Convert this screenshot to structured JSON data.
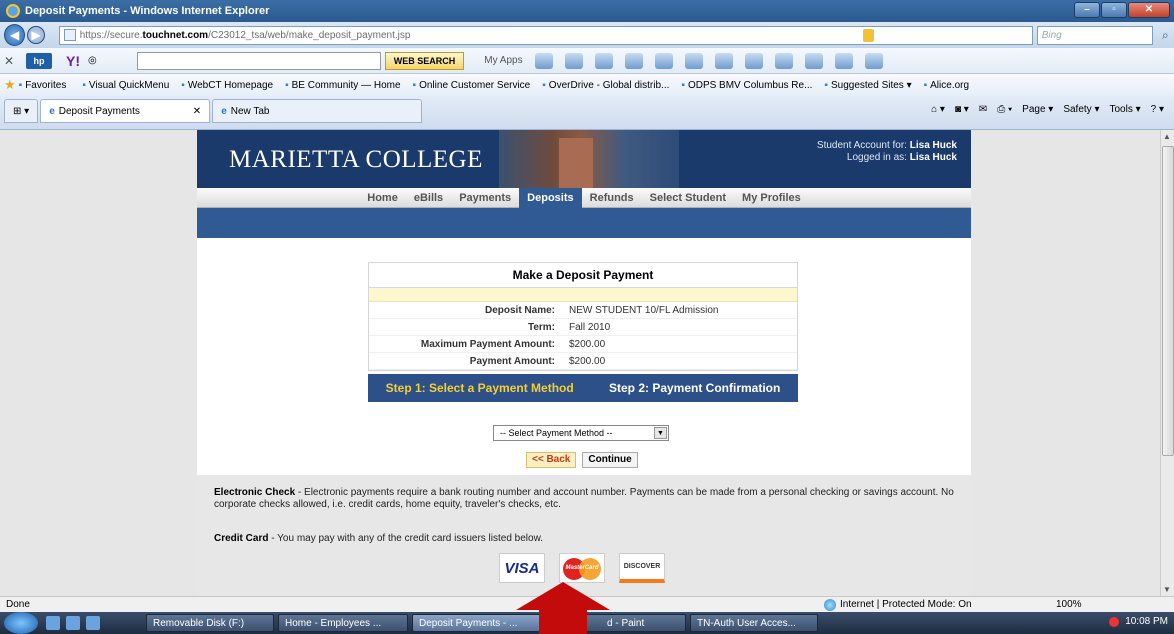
{
  "window": {
    "title": "Deposit Payments - Windows Internet Explorer"
  },
  "address": {
    "prefix": "https://secure.",
    "domain": "touchnet.com",
    "path": "/C23012_tsa/web/make_deposit_payment.jsp",
    "search_placeholder": "Bing"
  },
  "toolbar": {
    "websearch": "WEB SEARCH",
    "myapps": "My Apps"
  },
  "favorites": {
    "label": "Favorites",
    "items": [
      "Visual QuickMenu",
      "WebCT Homepage",
      "BE Community — Home",
      "Online Customer Service",
      "OverDrive - Global distrib...",
      "ODPS BMV Columbus Re...",
      "Suggested Sites ▾",
      "Alice.org"
    ]
  },
  "tabs": {
    "active": "Deposit Payments",
    "new": "New Tab"
  },
  "cmdbar": {
    "page": "Page ▾",
    "safety": "Safety ▾",
    "tools": "Tools ▾"
  },
  "site": {
    "college": "MARIETTA COLLEGE",
    "acct_label": "Student Account for:",
    "acct_name": "Lisa Huck",
    "login_label": "Logged in as:",
    "login_name": "Lisa Huck",
    "nav": [
      "Home",
      "eBills",
      "Payments",
      "Deposits",
      "Refunds",
      "Select Student",
      "My Profiles"
    ],
    "nav_active": "Deposits"
  },
  "deposit": {
    "title": "Make a Deposit Payment",
    "rows": [
      {
        "label": "Deposit Name:",
        "value": "NEW STUDENT 10/FL Admission"
      },
      {
        "label": "Term:",
        "value": "Fall 2010"
      },
      {
        "label": "Maximum Payment Amount:",
        "value": "$200.00"
      },
      {
        "label": "Payment Amount:",
        "value": "$200.00"
      }
    ]
  },
  "steps": {
    "step1": "Step 1: Select a Payment Method",
    "step2": "Step 2: Payment Confirmation"
  },
  "form": {
    "select_value": "-- Select Payment Method --",
    "back": "<< Back",
    "continue": "Continue"
  },
  "info": {
    "echeck_title": "Electronic Check",
    "echeck_text": " - Electronic payments require a bank routing number and account number. Payments can be made from a personal checking or savings account. No corporate checks allowed, i.e. credit cards, home equity, traveler's checks, etc.",
    "cc_title": "Credit Card",
    "cc_text": " - You may pay with any of the credit card issuers listed below."
  },
  "cards": {
    "visa": "VISA",
    "mastercard": "MasterCard",
    "discover": "DISCOVER"
  },
  "status": {
    "left": "Done",
    "zone": "Internet | Protected Mode: On",
    "zoom": "100%"
  },
  "taskbar": {
    "items": [
      "Removable Disk (F:)",
      "Home - Employees ...",
      "Deposit Payments - ...",
      "d - Paint",
      "TN-Auth User Acces..."
    ],
    "time": "10:08 PM"
  }
}
